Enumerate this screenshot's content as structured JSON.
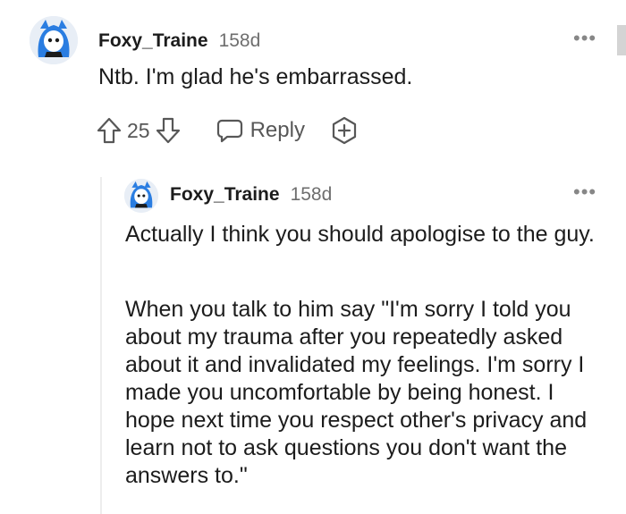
{
  "comment": {
    "username": "Foxy_Traine",
    "age": "158d",
    "body": "Ntb. I'm glad he's embarrassed.",
    "score": "25",
    "reply_label": "Reply",
    "icons": [
      "upvote-icon",
      "downvote-icon",
      "reply-bubble-icon",
      "award-icon",
      "more-options-icon"
    ]
  },
  "reply": {
    "username": "Foxy_Traine",
    "age": "158d",
    "paragraphs": [
      "Actually I think you should apologise to the guy.",
      "When you talk to him say \"I'm sorry I told you about my trauma after you repeatedly asked about it and invalidated my feelings. I'm sorry I made you uncomfortable by being honest. I hope next time you respect other's privacy and learn not to ask questions you don't want the answers to.\""
    ]
  },
  "colors": {
    "text": "#1c1c1c",
    "meta": "#6e6e6e",
    "action": "#575757",
    "thread_line": "#ededed",
    "avatar_blue": "#2a7de1"
  }
}
